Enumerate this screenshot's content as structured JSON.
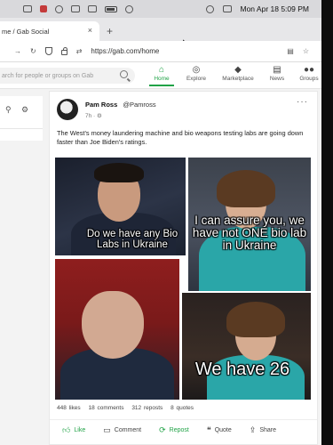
{
  "menubar": {
    "clock": "Mon Apr 18  5:09 PM"
  },
  "browser": {
    "tab_title": "me / Gab Social",
    "new_tab": "+",
    "close": "×",
    "url": "https://gab.com/home"
  },
  "gab": {
    "search_placeholder": "arch for people or groups on Gab",
    "nav": [
      {
        "label": "Home",
        "icon": "home-icon",
        "active": true
      },
      {
        "label": "Explore",
        "icon": "globe-icon"
      },
      {
        "label": "Marketplace",
        "icon": "tag-icon"
      },
      {
        "label": "News",
        "icon": "news-icon"
      },
      {
        "label": "Groups",
        "icon": "groups-icon"
      }
    ]
  },
  "post": {
    "author_name": "Pam Ross",
    "author_handle": "@Pamross",
    "time": "7h ·",
    "more": "···",
    "text": "The West's money laundering machine and bio weapons testing labs are going down faster than Joe Biden's ratings.",
    "meme_lines": [
      "Do we have any Bio Labs in Ukraine",
      "I can assure you, we have not ONE bio lab in Ukraine",
      "We have 26"
    ],
    "stats": {
      "likes": "448 likes",
      "comments": "18 comments",
      "reposts": "312 reposts",
      "quotes": "8 quotes"
    },
    "actions": {
      "like": "Like",
      "comment": "Comment",
      "repost": "Repost",
      "quote": "Quote",
      "share": "Share"
    }
  },
  "colors": {
    "gab_green": "#21a347",
    "menubar_bg": "#d9d9dc",
    "page_bg": "#f3f3f3"
  }
}
